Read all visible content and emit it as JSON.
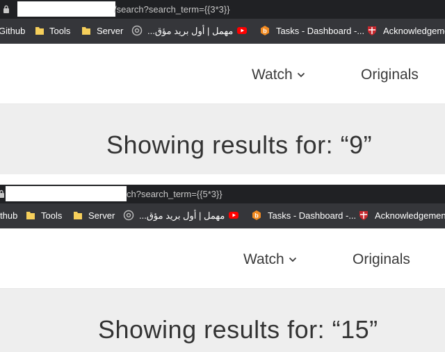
{
  "screenshots": [
    {
      "address_bar": {
        "url_text": "/search?search_term={{3*3}}"
      },
      "bookmarks": [
        "Github",
        "Tools",
        "Server",
        "مهمل | أول بريد مؤق...",
        "Tasks - Dashboard -...",
        "Acknowledgements"
      ],
      "nav": {
        "watch_label": "Watch",
        "originals_label": "Originals"
      },
      "results_heading": "Showing results for: “9”"
    },
    {
      "address_bar": {
        "url_text": "ch?search_term={{5*3}}"
      },
      "bookmarks": [
        "Github",
        "Tools",
        "Server",
        "مهمل | أول بريد مؤق...",
        "Tasks - Dashboard -...",
        "Acknowledgements"
      ],
      "nav": {
        "watch_label": "Watch",
        "originals_label": "Originals"
      },
      "results_heading": "Showing results for: “15”"
    }
  ],
  "icons": {
    "lock": "lock-icon",
    "folder": "folder-icon",
    "at": "at-sign-icon",
    "youtube": "youtube-icon",
    "tasks": "tasks-b-icon",
    "crest": "shield-crest-icon",
    "chevron": "chevron-down-icon"
  },
  "colors": {
    "address_bar": "#202124",
    "bookmark_bar": "#35363a",
    "folder": "#f6cf5b",
    "youtube": "#ff0000",
    "tasks": "#f28b22",
    "crest": "#c8282e",
    "results_band": "#eeeeee"
  }
}
